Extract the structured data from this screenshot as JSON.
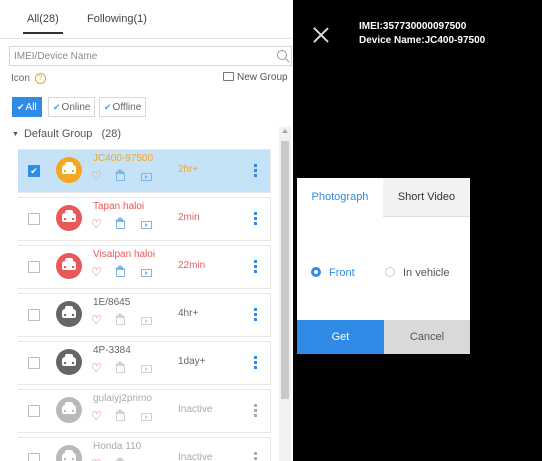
{
  "tabs": [
    {
      "label": "All(28)",
      "active": true
    },
    {
      "label": "Following(1)",
      "active": false
    }
  ],
  "search": {
    "placeholder": "IMEI/Device Name"
  },
  "icon_row": {
    "label": "Icon",
    "help_glyph": "?",
    "new_group_label": "New Group"
  },
  "filters": [
    {
      "label": "All",
      "active": true
    },
    {
      "label": "Online",
      "active": false
    },
    {
      "label": "Offline",
      "active": false
    }
  ],
  "group": {
    "label": "Default Group",
    "count": "(28)"
  },
  "devices": [
    {
      "name": "JC400-97500",
      "time": "2hr+",
      "checked": true,
      "status": "selected",
      "avatar_color": "#f5a623",
      "name_color": "#f5a623",
      "time_color": "#f5a623",
      "icon_color": "#f08a5d",
      "kebab_color": "#2f8be6"
    },
    {
      "name": "Tapan haloi",
      "time": "2min",
      "checked": false,
      "status": "online",
      "avatar_color": "#e85a5a",
      "name_color": "#e85a5a",
      "time_color": "#e85a5a",
      "icon_color": "#e85a5a",
      "kebab_color": "#2f8be6"
    },
    {
      "name": "Visalpan haloi",
      "time": "22min",
      "checked": false,
      "status": "online",
      "avatar_color": "#e85a5a",
      "name_color": "#e85a5a",
      "time_color": "#e85a5a",
      "icon_color": "#e85a5a",
      "kebab_color": "#2f8be6"
    },
    {
      "name": "1E/8645",
      "time": "4hr+",
      "checked": false,
      "status": "offline",
      "avatar_color": "#666666",
      "name_color": "#666666",
      "time_color": "#666666",
      "icon_color": "#e85a5a",
      "kebab_color": "#2f8be6"
    },
    {
      "name": "4P-3384",
      "time": "1day+",
      "checked": false,
      "status": "offline",
      "avatar_color": "#666666",
      "name_color": "#666666",
      "time_color": "#666666",
      "icon_color": "#e85a5a",
      "kebab_color": "#2f8be6"
    },
    {
      "name": "gulaiyj2primo",
      "time": "Inactive",
      "checked": false,
      "status": "inactive",
      "avatar_color": "#b9b9b9",
      "name_color": "#aaaaaa",
      "time_color": "#aaaaaa",
      "icon_color": "#e85a5a",
      "kebab_color": "#aaaaaa"
    },
    {
      "name": "Honda 110",
      "time": "Inactive",
      "checked": false,
      "status": "inactive",
      "avatar_color": "#b9b9b9",
      "name_color": "#aaaaaa",
      "time_color": "#aaaaaa",
      "icon_color": "#e85a5a",
      "kebab_color": "#aaaaaa"
    }
  ],
  "device_info": {
    "imei": "IMEI:357730000097500",
    "device_name": "Device Name:JC400-97500"
  },
  "dialog": {
    "tabs": [
      {
        "label": "Photograph",
        "active": true
      },
      {
        "label": "Short Video",
        "active": false
      }
    ],
    "options": [
      {
        "label": "Front",
        "selected": true
      },
      {
        "label": "In vehicle",
        "selected": false
      }
    ],
    "get_label": "Get",
    "cancel_label": "Cancel"
  },
  "colors": {
    "accent": "#2f8be6",
    "selected_row": "#c6e2f7",
    "overlay": "#000000"
  },
  "icons": [
    "search-icon",
    "help-icon",
    "folder-icon",
    "check-icon",
    "caret-down-icon",
    "car-icon",
    "heart-icon",
    "home-icon",
    "video-icon",
    "more-vertical-icon",
    "close-icon",
    "radio-icon"
  ]
}
